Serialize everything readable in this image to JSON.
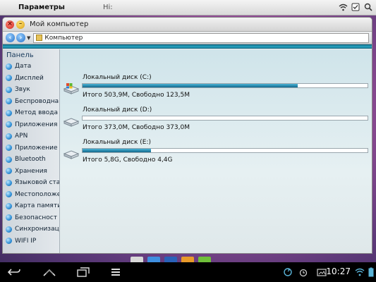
{
  "topbar": {
    "title": "Параметры",
    "hint": "Hi:"
  },
  "window": {
    "title": "Мой компьютер",
    "address": "Компьютер"
  },
  "sidebar": {
    "header": "Панель",
    "items": [
      {
        "label": "Дата"
      },
      {
        "label": "Дисплей"
      },
      {
        "label": "Звук"
      },
      {
        "label": "Беспроводна"
      },
      {
        "label": "Метод ввода"
      },
      {
        "label": "Приложения"
      },
      {
        "label": "APN"
      },
      {
        "label": "Приложение"
      },
      {
        "label": "Bluetooth"
      },
      {
        "label": "Хранения"
      },
      {
        "label": "Языковой ста"
      },
      {
        "label": "Местоположе"
      },
      {
        "label": "Карта памяти"
      },
      {
        "label": "Безопасност"
      },
      {
        "label": "Синхронизац"
      },
      {
        "label": "WIFI IP"
      }
    ]
  },
  "disks": [
    {
      "name": "Локальный диск (C:)",
      "info": "Итого 503,9M, Свободно 123,5M",
      "used_fraction": 0.755
    },
    {
      "name": "Локальный диск (D:)",
      "info": "Итого 373,0M, Свободно 373,0M",
      "used_fraction": 0.0
    },
    {
      "name": "Локальный диск (E:)",
      "info": "Итого 5,8G, Свободно 4,4G",
      "used_fraction": 0.24
    }
  ],
  "statusbar": {
    "time": "10:27"
  },
  "colors": {
    "accent": "#1a7e9c",
    "bar_fill": "#12688c"
  }
}
